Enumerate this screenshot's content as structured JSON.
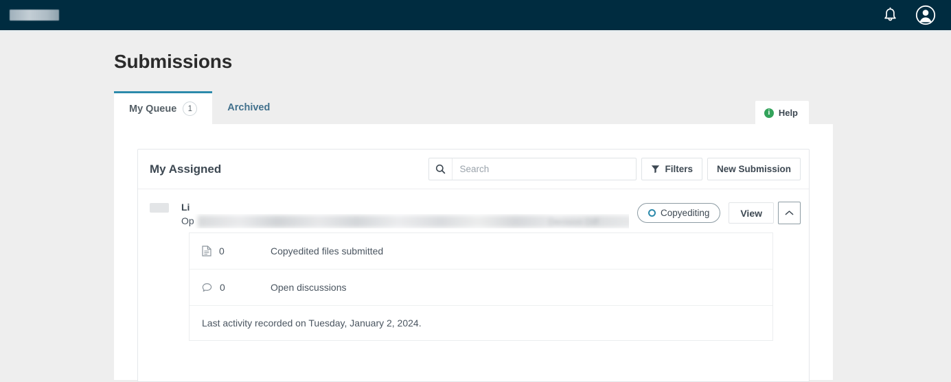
{
  "topbar": {
    "brand_label": "",
    "notifications_icon": "bell-icon",
    "avatar_icon": "user-avatar-icon",
    "background_color": "#002c40"
  },
  "page": {
    "title": "Submissions"
  },
  "tabs": [
    {
      "label": "My Queue",
      "badge": "1",
      "active": true
    },
    {
      "label": "Archived",
      "badge": "",
      "active": false
    }
  ],
  "help": {
    "label": "Help",
    "icon": "info-icon",
    "icon_color": "#33a35b"
  },
  "card": {
    "title": "My Assigned",
    "search": {
      "placeholder": "Search",
      "value": "",
      "icon": "search-icon"
    },
    "filters_button": {
      "label": "Filters",
      "icon": "funnel-icon"
    },
    "new_submission_button": {
      "label": "New Submission"
    }
  },
  "submission": {
    "author": "Li",
    "title_prefix": "Op",
    "meta_ghost": "Decision  Diff",
    "status": {
      "label": "Copyediting",
      "icon": "circle-outline-icon",
      "accent_color": "#2c8aab"
    },
    "view_button": {
      "label": "View"
    },
    "expand_button": {
      "icon": "chevron-up-icon"
    },
    "details": [
      {
        "icon": "document-icon",
        "count": "0",
        "label": "Copyedited files submitted"
      },
      {
        "icon": "discussion-bubble-icon",
        "count": "0",
        "label": "Open discussions"
      }
    ],
    "last_activity": "Last activity recorded on Tuesday, January 2, 2024."
  },
  "colors": {
    "header_navy": "#002c40",
    "tab_accent": "#2c8aab",
    "page_background": "#eeeeee",
    "panel_background": "#ffffff"
  }
}
